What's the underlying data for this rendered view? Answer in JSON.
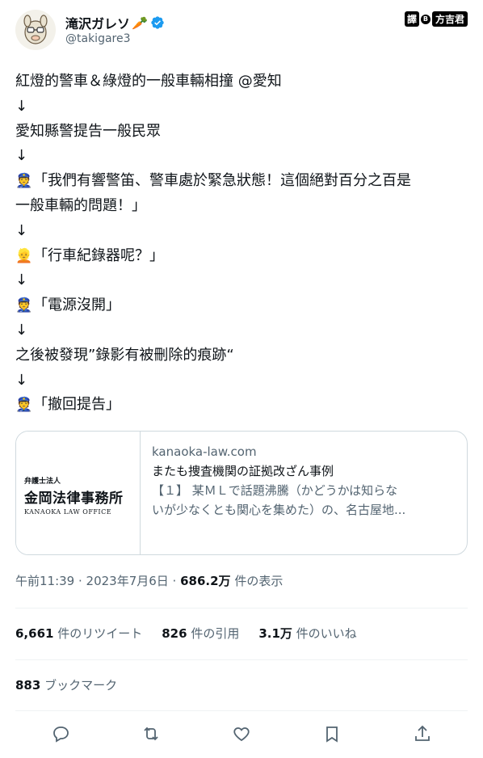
{
  "author": {
    "name": "滝沢ガレソ",
    "name_emoji": "🥕",
    "handle": "@takigare3",
    "verified_icon": "verified-badge-icon"
  },
  "translator_badge": {
    "part1": "譯",
    "part2": "B",
    "part3": "方吉君"
  },
  "tweet": {
    "lines": [
      {
        "emoji": "",
        "text": "紅燈的警車＆綠燈的一般車輛相撞 @愛知"
      },
      {
        "emoji": "",
        "text": "↓"
      },
      {
        "emoji": "",
        "text": "愛知縣警提告一般民眾"
      },
      {
        "emoji": "",
        "text": "↓"
      },
      {
        "emoji": "👮",
        "text": "「我們有響警笛、警車處於緊急狀態！這個絕對百分之百是"
      },
      {
        "emoji": "",
        "text": "一般車輛的問題！」"
      },
      {
        "emoji": "",
        "text": "↓"
      },
      {
        "emoji": "👱",
        "text": "「行車紀錄器呢？」"
      },
      {
        "emoji": "",
        "text": "↓"
      },
      {
        "emoji": "👮",
        "text": "「電源沒開」"
      },
      {
        "emoji": "",
        "text": "↓"
      },
      {
        "emoji": "",
        "text": "之後被發現”錄影有被刪除的痕跡“"
      },
      {
        "emoji": "",
        "text": "↓"
      },
      {
        "emoji": "👮",
        "text": "「撤回提告」"
      }
    ]
  },
  "card": {
    "thumb_small": "弁護士法人",
    "thumb_big": "金岡法律事務所",
    "thumb_en": "KANAOKA LAW OFFICE",
    "domain": "kanaoka-law.com",
    "title": "またも捜査機関の証拠改ざん事例",
    "desc_line1": "【１】 某ＭＬで話題沸騰（かどうかは知らな",
    "desc_line2": "いが少なくとも関心を集めた）の、名古屋地..."
  },
  "meta": {
    "time": "午前11:39 · 2023年7月6日 · ",
    "views": "686.2万",
    "views_label": " 件の表示"
  },
  "stats": {
    "retweets": "6,661",
    "retweets_label": " 件のリツイート",
    "quotes": "826",
    "quotes_label": " 件の引用",
    "likes": "3.1万",
    "likes_label": " 件のいいね"
  },
  "bookmarks": {
    "count": "883",
    "label": " ブックマーク"
  },
  "actions": [
    "reply-icon",
    "retweet-icon",
    "like-icon",
    "bookmark-icon",
    "share-icon"
  ],
  "colors": {
    "verified": "#1d9bf0",
    "secondary_text": "#536471",
    "border": "#cfd9de"
  }
}
